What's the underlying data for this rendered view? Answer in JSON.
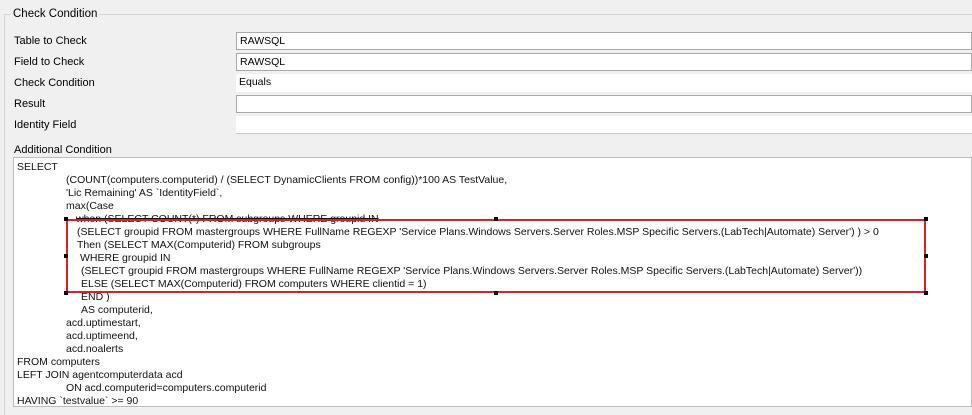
{
  "group": {
    "title": "Check Condition"
  },
  "form": {
    "table_label": "Table to Check",
    "table_value": "RAWSQL",
    "field_label": "Field to Check",
    "field_value": "RAWSQL",
    "condition_label": "Check Condition",
    "condition_value": "Equals",
    "result_label": "Result",
    "result_value": "",
    "identity_label": "Identity Field",
    "identity_value": "",
    "additional_label": "Additional Condition"
  },
  "sql": {
    "lines": [
      "SELECT",
      "(COUNT(computers.computerid) / (SELECT DynamicClients FROM config))*100 AS TestValue,",
      "'Lic Remaining' AS `IdentityField`,",
      "max(Case",
      "when (SELECT COUNT(*) FROM subgroups WHERE groupid IN",
      "(SELECT groupid FROM mastergroups WHERE FullName REGEXP 'Service Plans.Windows Servers.Server Roles.MSP Specific Servers.(LabTech|Automate) Server') ) > 0",
      "Then (SELECT MAX(Computerid) FROM subgroups",
      "WHERE groupid IN",
      "(SELECT groupid FROM mastergroups WHERE FullName REGEXP 'Service Plans.Windows Servers.Server Roles.MSP Specific Servers.(LabTech|Automate) Server'))",
      "ELSE (SELECT MAX(Computerid) FROM computers WHERE clientid = 1)",
      "END )",
      "AS computerid,",
      "acd.uptimestart,",
      "acd.uptimeend,",
      "acd.noalerts",
      "FROM computers",
      "LEFT JOIN agentcomputerdata acd",
      "ON acd.computerid=computers.computerid",
      "HAVING `testvalue` >= 90"
    ]
  }
}
